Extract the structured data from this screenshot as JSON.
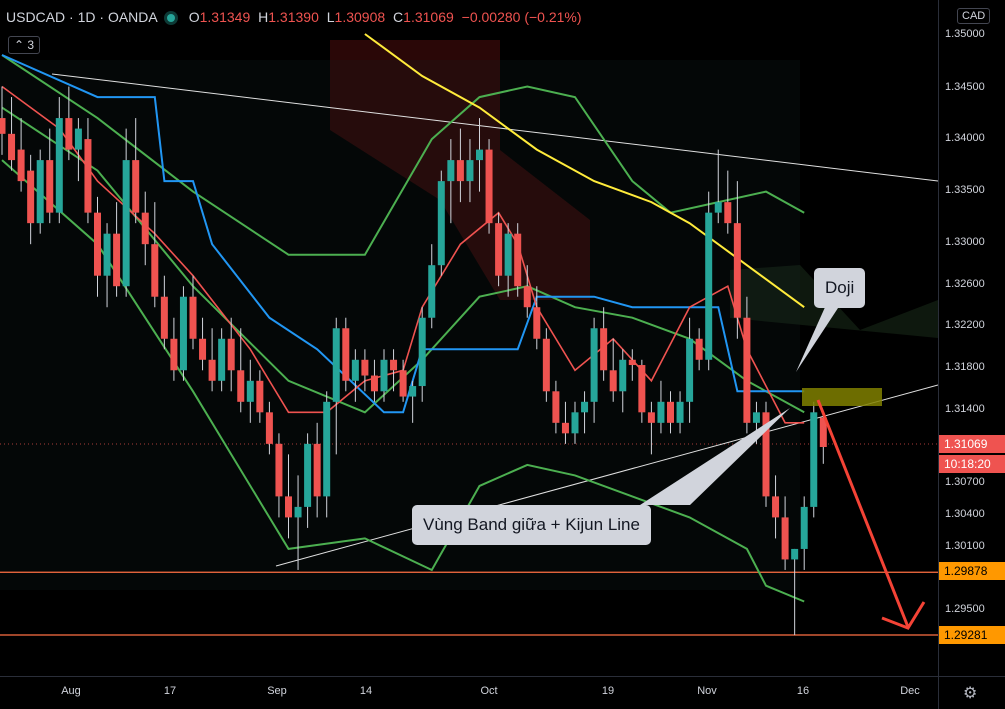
{
  "legend": {
    "symbol": "USDCAD",
    "interval": "1D",
    "broker": "OANDA",
    "o_key": "O",
    "o": "1.31349",
    "h_key": "H",
    "h": "1.31390",
    "l_key": "L",
    "l": "1.30908",
    "c_key": "C",
    "c": "1.31069",
    "change": "−0.00280 (−0.21%)",
    "indicator_count": "3",
    "sep": "·"
  },
  "axis": {
    "currency": "CAD",
    "price_ticks": [
      "1.35000",
      "1.34500",
      "1.34000",
      "1.33500",
      "1.33000",
      "1.32600",
      "1.32200",
      "1.31800",
      "1.31400",
      "1.30700",
      "1.30400",
      "1.30100",
      "1.29500"
    ],
    "time_ticks": [
      "Aug",
      "17",
      "Sep",
      "14",
      "Oct",
      "19",
      "Nov",
      "16",
      "Dec"
    ],
    "price_labels": {
      "last": "1.31069",
      "countdown": "10:18:20",
      "support1": "1.29878",
      "support2": "1.29281"
    }
  },
  "annotations": {
    "doji": "Doji",
    "band": "Vùng Band giữa + Kijun Line"
  },
  "colors": {
    "bull": "#26a69a",
    "bear": "#ef5350",
    "bb": "#4caf50",
    "kijun": "#2196f3",
    "ema": "#ffeb3b",
    "support": "#ff9800",
    "zone": "#808000"
  },
  "chart_data": {
    "type": "candlestick",
    "symbol": "USDCAD",
    "interval": "1D",
    "ylim": [
      1.2925,
      1.3505
    ],
    "candles": [
      [
        1.342,
        1.345,
        1.3385,
        1.3405
      ],
      [
        1.3405,
        1.344,
        1.337,
        1.338
      ],
      [
        1.339,
        1.342,
        1.335,
        1.336
      ],
      [
        1.337,
        1.3385,
        1.33,
        1.332
      ],
      [
        1.332,
        1.339,
        1.331,
        1.338
      ],
      [
        1.338,
        1.341,
        1.332,
        1.333
      ],
      [
        1.333,
        1.344,
        1.332,
        1.342
      ],
      [
        1.342,
        1.345,
        1.338,
        1.339
      ],
      [
        1.339,
        1.342,
        1.336,
        1.341
      ],
      [
        1.34,
        1.342,
        1.332,
        1.333
      ],
      [
        1.333,
        1.3345,
        1.325,
        1.327
      ],
      [
        1.327,
        1.332,
        1.324,
        1.331
      ],
      [
        1.331,
        1.334,
        1.325,
        1.326
      ],
      [
        1.326,
        1.341,
        1.325,
        1.338
      ],
      [
        1.338,
        1.342,
        1.332,
        1.333
      ],
      [
        1.333,
        1.335,
        1.328,
        1.33
      ],
      [
        1.33,
        1.334,
        1.324,
        1.325
      ],
      [
        1.325,
        1.327,
        1.32,
        1.321
      ],
      [
        1.321,
        1.323,
        1.317,
        1.318
      ],
      [
        1.318,
        1.326,
        1.317,
        1.325
      ],
      [
        1.325,
        1.327,
        1.32,
        1.321
      ],
      [
        1.321,
        1.323,
        1.318,
        1.319
      ],
      [
        1.319,
        1.322,
        1.316,
        1.317
      ],
      [
        1.317,
        1.322,
        1.316,
        1.321
      ],
      [
        1.321,
        1.323,
        1.316,
        1.318
      ],
      [
        1.318,
        1.322,
        1.314,
        1.315
      ],
      [
        1.315,
        1.319,
        1.313,
        1.317
      ],
      [
        1.317,
        1.318,
        1.313,
        1.314
      ],
      [
        1.314,
        1.315,
        1.31,
        1.311
      ],
      [
        1.311,
        1.312,
        1.304,
        1.306
      ],
      [
        1.306,
        1.31,
        1.302,
        1.304
      ],
      [
        1.304,
        1.308,
        1.299,
        1.305
      ],
      [
        1.305,
        1.312,
        1.303,
        1.311
      ],
      [
        1.311,
        1.313,
        1.304,
        1.306
      ],
      [
        1.306,
        1.316,
        1.304,
        1.315
      ],
      [
        1.315,
        1.323,
        1.31,
        1.322
      ],
      [
        1.322,
        1.323,
        1.316,
        1.317
      ],
      [
        1.317,
        1.32,
        1.315,
        1.319
      ],
      [
        1.319,
        1.32,
        1.316,
        1.3175
      ],
      [
        1.3175,
        1.319,
        1.315,
        1.316
      ],
      [
        1.316,
        1.32,
        1.315,
        1.319
      ],
      [
        1.319,
        1.32,
        1.316,
        1.318
      ],
      [
        1.318,
        1.319,
        1.315,
        1.3155
      ],
      [
        1.3155,
        1.317,
        1.313,
        1.3165
      ],
      [
        1.3165,
        1.324,
        1.315,
        1.323
      ],
      [
        1.323,
        1.33,
        1.322,
        1.328
      ],
      [
        1.328,
        1.337,
        1.327,
        1.336
      ],
      [
        1.336,
        1.34,
        1.332,
        1.338
      ],
      [
        1.338,
        1.341,
        1.334,
        1.336
      ],
      [
        1.336,
        1.34,
        1.334,
        1.338
      ],
      [
        1.338,
        1.342,
        1.335,
        1.339
      ],
      [
        1.339,
        1.34,
        1.331,
        1.332
      ],
      [
        1.332,
        1.333,
        1.326,
        1.327
      ],
      [
        1.327,
        1.332,
        1.325,
        1.331
      ],
      [
        1.331,
        1.332,
        1.325,
        1.326
      ],
      [
        1.326,
        1.328,
        1.323,
        1.324
      ],
      [
        1.324,
        1.326,
        1.32,
        1.321
      ],
      [
        1.321,
        1.322,
        1.315,
        1.316
      ],
      [
        1.316,
        1.317,
        1.312,
        1.313
      ],
      [
        1.313,
        1.315,
        1.311,
        1.312
      ],
      [
        1.312,
        1.315,
        1.311,
        1.314
      ],
      [
        1.314,
        1.316,
        1.312,
        1.315
      ],
      [
        1.315,
        1.323,
        1.313,
        1.322
      ],
      [
        1.322,
        1.324,
        1.317,
        1.318
      ],
      [
        1.318,
        1.321,
        1.315,
        1.316
      ],
      [
        1.316,
        1.32,
        1.314,
        1.319
      ],
      [
        1.319,
        1.32,
        1.317,
        1.3185
      ],
      [
        1.3185,
        1.319,
        1.313,
        1.314
      ],
      [
        1.314,
        1.315,
        1.31,
        1.313
      ],
      [
        1.313,
        1.317,
        1.312,
        1.315
      ],
      [
        1.315,
        1.316,
        1.312,
        1.313
      ],
      [
        1.313,
        1.316,
        1.312,
        1.315
      ],
      [
        1.315,
        1.323,
        1.313,
        1.321
      ],
      [
        1.321,
        1.322,
        1.318,
        1.319
      ],
      [
        1.319,
        1.335,
        1.318,
        1.333
      ],
      [
        1.333,
        1.339,
        1.332,
        1.334
      ],
      [
        1.334,
        1.337,
        1.331,
        1.332
      ],
      [
        1.332,
        1.336,
        1.321,
        1.323
      ],
      [
        1.323,
        1.325,
        1.312,
        1.313
      ],
      [
        1.313,
        1.315,
        1.311,
        1.314
      ],
      [
        1.314,
        1.315,
        1.305,
        1.306
      ],
      [
        1.306,
        1.308,
        1.302,
        1.304
      ],
      [
        1.304,
        1.306,
        1.299,
        1.3
      ],
      [
        1.3,
        1.301,
        1.2928,
        1.301
      ],
      [
        1.301,
        1.306,
        1.299,
        1.305
      ],
      [
        1.305,
        1.315,
        1.304,
        1.314
      ],
      [
        1.3135,
        1.3139,
        1.3091,
        1.3107
      ]
    ],
    "series": [
      {
        "kind": "bb-upper",
        "values": [
          [
            0,
            1.348
          ],
          [
            10,
            1.342
          ],
          [
            20,
            1.335
          ],
          [
            30,
            1.329
          ],
          [
            38,
            1.329
          ],
          [
            45,
            1.34
          ],
          [
            50,
            1.344
          ],
          [
            55,
            1.345
          ],
          [
            60,
            1.344
          ],
          [
            66,
            1.336
          ],
          [
            70,
            1.333
          ],
          [
            75,
            1.334
          ],
          [
            80,
            1.335
          ],
          [
            84,
            1.333
          ]
        ]
      },
      {
        "kind": "bb-middle",
        "values": [
          [
            0,
            1.343
          ],
          [
            10,
            1.337
          ],
          [
            20,
            1.326
          ],
          [
            30,
            1.317
          ],
          [
            38,
            1.314
          ],
          [
            44,
            1.319
          ],
          [
            50,
            1.325
          ],
          [
            55,
            1.326
          ],
          [
            60,
            1.324
          ],
          [
            66,
            1.323
          ],
          [
            72,
            1.321
          ],
          [
            78,
            1.317
          ],
          [
            84,
            1.314
          ]
        ]
      },
      {
        "kind": "bb-lower",
        "values": [
          [
            0,
            1.338
          ],
          [
            10,
            1.33
          ],
          [
            20,
            1.316
          ],
          [
            28,
            1.304
          ],
          [
            30,
            1.301
          ],
          [
            38,
            1.302
          ],
          [
            45,
            1.299
          ],
          [
            50,
            1.307
          ],
          [
            55,
            1.309
          ],
          [
            60,
            1.308
          ],
          [
            66,
            1.306
          ],
          [
            72,
            1.304
          ],
          [
            78,
            1.301
          ],
          [
            80,
            1.2975
          ],
          [
            84,
            1.296
          ]
        ]
      },
      {
        "kind": "kijun",
        "values": [
          [
            0,
            1.348
          ],
          [
            10,
            1.344
          ],
          [
            16,
            1.344
          ],
          [
            17,
            1.336
          ],
          [
            20,
            1.336
          ],
          [
            22,
            1.33
          ],
          [
            28,
            1.323
          ],
          [
            33,
            1.32
          ],
          [
            40,
            1.314
          ],
          [
            42,
            1.314
          ],
          [
            44,
            1.32
          ],
          [
            50,
            1.32
          ],
          [
            54,
            1.32
          ],
          [
            56,
            1.325
          ],
          [
            58,
            1.325
          ],
          [
            62,
            1.325
          ],
          [
            66,
            1.324
          ],
          [
            72,
            1.324
          ],
          [
            75,
            1.324
          ],
          [
            77,
            1.316
          ],
          [
            84,
            1.316
          ]
        ]
      },
      {
        "kind": "tenkan",
        "values": [
          [
            0,
            1.345
          ],
          [
            6,
            1.341
          ],
          [
            10,
            1.336
          ],
          [
            16,
            1.331
          ],
          [
            20,
            1.327
          ],
          [
            26,
            1.32
          ],
          [
            30,
            1.314
          ],
          [
            34,
            1.314
          ],
          [
            38,
            1.317
          ],
          [
            42,
            1.318
          ],
          [
            44,
            1.324
          ],
          [
            48,
            1.33
          ],
          [
            52,
            1.333
          ],
          [
            54,
            1.33
          ],
          [
            56,
            1.324
          ],
          [
            60,
            1.318
          ],
          [
            64,
            1.321
          ],
          [
            68,
            1.317
          ],
          [
            72,
            1.324
          ],
          [
            76,
            1.326
          ],
          [
            78,
            1.32
          ],
          [
            82,
            1.313
          ],
          [
            84,
            1.313
          ]
        ]
      },
      {
        "kind": "ema",
        "values": [
          [
            38,
            1.35
          ],
          [
            44,
            1.346
          ],
          [
            50,
            1.343
          ],
          [
            56,
            1.339
          ],
          [
            62,
            1.336
          ],
          [
            68,
            1.334
          ],
          [
            72,
            1.332
          ],
          [
            78,
            1.328
          ],
          [
            84,
            1.324
          ]
        ]
      }
    ],
    "levels": [
      1.29878,
      1.29281
    ]
  }
}
